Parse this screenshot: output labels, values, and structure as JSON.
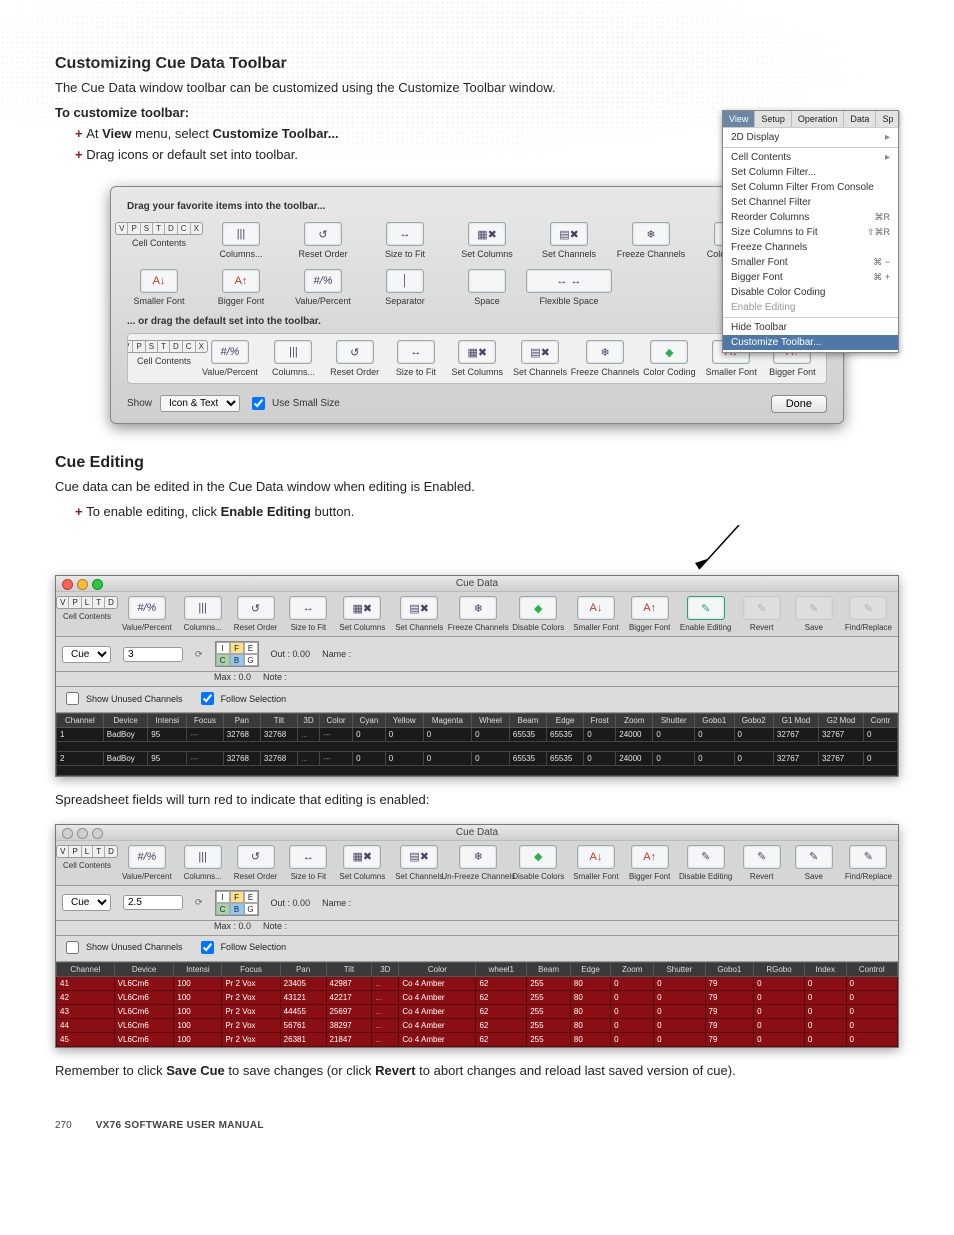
{
  "section1": {
    "title": "Customizing Cue Data Toolbar",
    "intro": "The Cue Data window toolbar can be customized using the Customize Toolbar window.",
    "subhead": "To customize toolbar:",
    "step1_pre": "At ",
    "step1_bold1": "View",
    "step1_mid": " menu, select ",
    "step1_bold2": "Customize Toolbar...",
    "step2": "Drag icons or default set into toolbar."
  },
  "menu": {
    "tabs": [
      "View",
      "Setup",
      "Operation",
      "Data",
      "Sp"
    ],
    "items": [
      {
        "label": "2D Display",
        "arrow": "▸"
      },
      {
        "label": "Cell Contents",
        "arrow": "▸"
      },
      {
        "label": "Set Column Filter..."
      },
      {
        "label": "Set Column Filter From Console"
      },
      {
        "label": "Set Channel Filter"
      },
      {
        "label": "Reorder Columns",
        "hk": "⌘R"
      },
      {
        "label": "Size Columns to Fit",
        "hk": "⇧⌘R"
      },
      {
        "label": "Freeze Channels"
      },
      {
        "label": "Smaller Font",
        "hk": "⌘ −"
      },
      {
        "label": "Bigger Font",
        "hk": "⌘ +"
      },
      {
        "label": "Disable Color Coding"
      },
      {
        "label": "Enable Editing",
        "disabled": true
      },
      {
        "label": "Hide Toolbar"
      },
      {
        "label": "Customize Toolbar...",
        "highlight": true
      }
    ]
  },
  "dialog": {
    "hint": "Drag your favorite items into the toolbar...",
    "tools_row1": [
      {
        "id": "cell-contents",
        "label": "Cell Contents",
        "glyph": "V P S T D C X",
        "seg": true
      },
      {
        "id": "columns",
        "label": "Columns...",
        "glyph": "|||"
      },
      {
        "id": "reset-order",
        "label": "Reset Order",
        "glyph": "↺"
      },
      {
        "id": "size-to-fit",
        "label": "Size to Fit",
        "glyph": "↔"
      },
      {
        "id": "set-columns",
        "label": "Set Columns",
        "glyph": "▦✖"
      },
      {
        "id": "set-channels",
        "label": "Set Channels",
        "glyph": "▤✖"
      },
      {
        "id": "freeze-channels",
        "label": "Freeze Channels",
        "glyph": "❄"
      },
      {
        "id": "color-coding",
        "label": "Color Coding",
        "glyph": "◆",
        "color": "#2bb24c"
      }
    ],
    "tools_row2": [
      {
        "id": "smaller-font",
        "label": "Smaller Font",
        "glyph": "A↓",
        "color": "#c0392b"
      },
      {
        "id": "bigger-font",
        "label": "Bigger Font",
        "glyph": "A↑",
        "color": "#c0392b"
      },
      {
        "id": "value-percent",
        "label": "Value/Percent",
        "glyph": "#/%",
        "italic": true
      },
      {
        "id": "separator",
        "label": "Separator",
        "glyph": "│"
      },
      {
        "id": "space",
        "label": "Space",
        "glyph": " "
      },
      {
        "id": "flexible-space",
        "label": "Flexible Space",
        "glyph": "↔  ↔",
        "wide": true
      }
    ],
    "subhint": "... or drag the default set into the toolbar.",
    "default_tools": [
      {
        "id": "cell-contents",
        "label": "Cell Contents",
        "glyph": "V P S T D C X",
        "seg": true
      },
      {
        "id": "value-percent",
        "label": "Value/Percent",
        "glyph": "#/%",
        "italic": true
      },
      {
        "id": "columns",
        "label": "Columns...",
        "glyph": "|||"
      },
      {
        "id": "reset-order",
        "label": "Reset Order",
        "glyph": "↺"
      },
      {
        "id": "size-to-fit",
        "label": "Size to Fit",
        "glyph": "↔"
      },
      {
        "id": "set-columns",
        "label": "Set Columns",
        "glyph": "▦✖"
      },
      {
        "id": "set-channels",
        "label": "Set Channels",
        "glyph": "▤✖"
      },
      {
        "id": "freeze-channels",
        "label": "Freeze Channels",
        "glyph": "❄"
      },
      {
        "id": "color-coding",
        "label": "Color Coding",
        "glyph": "◆",
        "color": "#2bb24c"
      },
      {
        "id": "smaller-font",
        "label": "Smaller Font",
        "glyph": "A↓",
        "color": "#c0392b"
      },
      {
        "id": "bigger-font",
        "label": "Bigger Font",
        "glyph": "A↑",
        "color": "#c0392b"
      }
    ],
    "show_label": "Show",
    "show_value": "Icon & Text",
    "use_small": "Use Small Size",
    "done": "Done"
  },
  "section2": {
    "title": "Cue Editing",
    "intro": "Cue data can be edited in the Cue Data window when editing is Enabled.",
    "step1_pre": "To enable editing, click ",
    "step1_bold": "Enable Editing",
    "step1_post": " button."
  },
  "cuewin1": {
    "title": "Cue Data",
    "toolbar": [
      {
        "id": "cell-contents",
        "label": "Cell Contents",
        "glyph": "V P L T D",
        "seg": true
      },
      {
        "id": "value-percent",
        "label": "Value/Percent",
        "glyph": "#/%",
        "italic": true
      },
      {
        "id": "columns",
        "label": "Columns...",
        "glyph": "|||"
      },
      {
        "id": "reset-order",
        "label": "Reset Order",
        "glyph": "↺"
      },
      {
        "id": "size-to-fit",
        "label": "Size to Fit",
        "glyph": "↔"
      },
      {
        "id": "set-columns",
        "label": "Set Columns",
        "glyph": "▦✖"
      },
      {
        "id": "set-channels",
        "label": "Set Channels",
        "glyph": "▤✖"
      },
      {
        "id": "freeze-channels",
        "label": "Freeze Channels",
        "glyph": "❄"
      },
      {
        "id": "disable-colors",
        "label": "Disable Colors",
        "glyph": "◆",
        "color": "#2bb24c"
      },
      {
        "id": "smaller-font",
        "label": "Smaller Font",
        "glyph": "A↓",
        "color": "#c0392b"
      },
      {
        "id": "bigger-font",
        "label": "Bigger Font",
        "glyph": "A↑",
        "color": "#c0392b"
      },
      {
        "id": "enable-editing",
        "label": "Enable Editing",
        "glyph": "✎",
        "highlight": true
      },
      {
        "id": "revert",
        "label": "Revert",
        "glyph": "✎",
        "faded": true
      },
      {
        "id": "save",
        "label": "Save",
        "glyph": "✎",
        "faded": true
      },
      {
        "id": "find-replace",
        "label": "Find/Replace",
        "glyph": "✎",
        "faded": true
      }
    ],
    "cue_select": "Cue",
    "cue_value": "3",
    "ife": [
      "I",
      "F",
      "E",
      "C",
      "B",
      "G"
    ],
    "out": "Out : 0.00",
    "max": "Max : 0.0",
    "name": "Name :",
    "note": "Note :",
    "show_unused": "Show Unused Channels",
    "follow_sel": "Follow Selection",
    "headers": [
      "Channel",
      "Device",
      "Intensi",
      "Focus",
      "Pan",
      "Tilt",
      "3D",
      "Color",
      "Cyan",
      "Yellow",
      "Magenta",
      "Wheel",
      "Beam",
      "Edge",
      "Frost",
      "Zoom",
      "Shutter",
      "Gobo1",
      "Gobo2",
      "G1 Mod",
      "G2 Mod",
      "Contr"
    ],
    "rows": [
      [
        "1",
        "BadBoy",
        "95",
        "---",
        "32768",
        "32768",
        "...",
        "---",
        "0",
        "0",
        "0",
        "0",
        "65535",
        "65535",
        "0",
        "24000",
        "0",
        "0",
        "0",
        "32767",
        "32767",
        "0"
      ],
      [
        "2",
        "BadBoy",
        "95",
        "---",
        "32768",
        "32768",
        "...",
        "---",
        "0",
        "0",
        "0",
        "0",
        "65535",
        "65535",
        "0",
        "24000",
        "0",
        "0",
        "0",
        "32767",
        "32767",
        "0"
      ]
    ]
  },
  "midtext": "Spreadsheet fields will turn red to indicate that editing is enabled:",
  "cuewin2": {
    "title": "Cue Data",
    "toolbar": [
      {
        "id": "cell-contents",
        "label": "Cell Contents",
        "glyph": "V P L T D",
        "seg": true
      },
      {
        "id": "value-percent",
        "label": "Value/Percent",
        "glyph": "#/%",
        "italic": true
      },
      {
        "id": "columns",
        "label": "Columns...",
        "glyph": "|||"
      },
      {
        "id": "reset-order",
        "label": "Reset Order",
        "glyph": "↺"
      },
      {
        "id": "size-to-fit",
        "label": "Size to Fit",
        "glyph": "↔"
      },
      {
        "id": "set-columns",
        "label": "Set Columns",
        "glyph": "▦✖"
      },
      {
        "id": "set-channels",
        "label": "Set Channels",
        "glyph": "▤✖"
      },
      {
        "id": "unfreeze-channels",
        "label": "Un-Freeze Channels",
        "glyph": "❄"
      },
      {
        "id": "disable-colors",
        "label": "Disable Colors",
        "glyph": "◆",
        "color": "#2bb24c"
      },
      {
        "id": "smaller-font",
        "label": "Smaller Font",
        "glyph": "A↓",
        "color": "#c0392b"
      },
      {
        "id": "bigger-font",
        "label": "Bigger Font",
        "glyph": "A↑",
        "color": "#c0392b"
      },
      {
        "id": "disable-editing",
        "label": "Disable Editing",
        "glyph": "✎"
      },
      {
        "id": "revert",
        "label": "Revert",
        "glyph": "✎"
      },
      {
        "id": "save",
        "label": "Save",
        "glyph": "✎"
      },
      {
        "id": "find-replace",
        "label": "Find/Replace",
        "glyph": "✎"
      }
    ],
    "cue_select": "Cue",
    "cue_value": "2.5",
    "out": "Out : 0.00",
    "max": "Max : 0.0",
    "name": "Name :",
    "note": "Note :",
    "show_unused": "Show Unused Channels",
    "follow_sel": "Follow Selection",
    "headers": [
      "Channel",
      "Device",
      "Intensi",
      "Focus",
      "Pan",
      "Tilt",
      "3D",
      "Color",
      "wheel1",
      "Beam",
      "Edge",
      "Zoom",
      "Shutter",
      "Gobo1",
      "RGobo",
      "Index",
      "Control"
    ],
    "rows": [
      [
        "41",
        "VL6Cm6",
        "100",
        "Pr 2 Vox",
        "23405",
        "42987",
        "...",
        "Co 4 Amber",
        "62",
        "255",
        "80",
        "0",
        "0",
        "79",
        "0",
        "0",
        "0"
      ],
      [
        "42",
        "VL6Cm6",
        "100",
        "Pr 2 Vox",
        "43121",
        "42217",
        "...",
        "Co 4 Amber",
        "62",
        "255",
        "80",
        "0",
        "0",
        "79",
        "0",
        "0",
        "0"
      ],
      [
        "43",
        "VL6Cm6",
        "100",
        "Pr 2 Vox",
        "44455",
        "25697",
        "...",
        "Co 4 Amber",
        "62",
        "255",
        "80",
        "0",
        "0",
        "79",
        "0",
        "0",
        "0"
      ],
      [
        "44",
        "VL6Cm6",
        "100",
        "Pr 2 Vox",
        "56761",
        "38297",
        "...",
        "Co 4 Amber",
        "62",
        "255",
        "80",
        "0",
        "0",
        "79",
        "0",
        "0",
        "0"
      ],
      [
        "45",
        "VL6Cm6",
        "100",
        "Pr 2 Vox",
        "26381",
        "21847",
        "...",
        "Co 4 Amber",
        "62",
        "255",
        "80",
        "0",
        "0",
        "79",
        "0",
        "0",
        "0"
      ]
    ]
  },
  "closing_pre": "Remember to click ",
  "closing_b1": "Save Cue",
  "closing_mid": " to save changes (or click ",
  "closing_b2": "Revert",
  "closing_post": " to abort changes and reload last saved version of cue).",
  "footer": {
    "page": "270",
    "manual": "VX76 SOFTWARE USER MANUAL"
  }
}
